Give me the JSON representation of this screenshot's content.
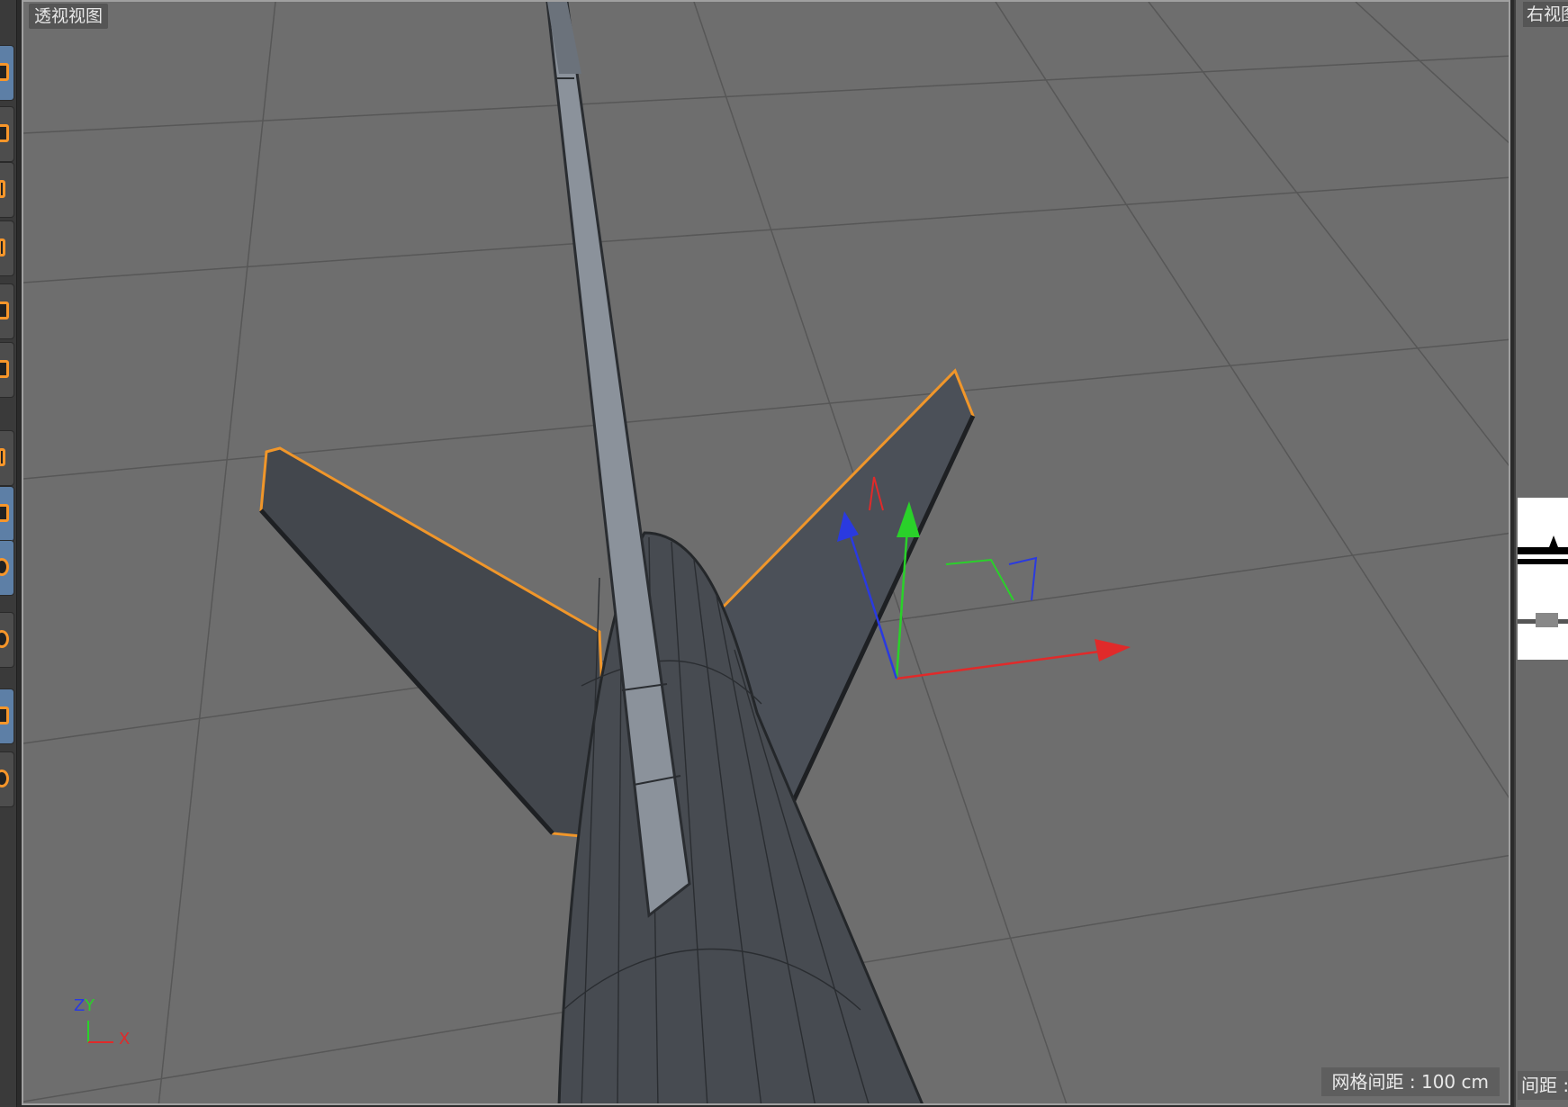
{
  "viewport": {
    "title": "透视视图",
    "grid_spacing": "网格间距 : 100 cm",
    "axis_gizmo": {
      "y_label": "Y",
      "z_label": "Z",
      "x_label": "X"
    },
    "colors": {
      "background": "#6e6e6e",
      "grid_line": "#5a5a5a",
      "model_fill": "#43474d",
      "model_edge": "#2a2d31",
      "model_highlight": "#8b929b",
      "selection_outline": "#f0962a",
      "axis_x": "#e02a2a",
      "axis_y": "#2ad12a",
      "axis_z": "#2a3ae0"
    }
  },
  "right_viewport": {
    "title": "右视图",
    "grid_spacing": "间距 :"
  },
  "toolbar": {
    "tools": [
      {
        "icon": "cube-icon",
        "active": true
      },
      {
        "icon": "camera-icon",
        "active": false
      },
      {
        "icon": "plane-icon",
        "active": false
      },
      {
        "icon": "spline-pen-icon",
        "active": false
      },
      {
        "icon": "cylinder-icon",
        "active": false
      },
      {
        "icon": "box-icon",
        "active": false
      },
      {
        "icon": "arrow-icon",
        "active": false
      },
      {
        "icon": "subdivision-icon",
        "active": true
      },
      {
        "icon": "sphere-icon",
        "active": true
      },
      {
        "icon": "deformer-icon",
        "active": false
      },
      {
        "icon": "scene-icon",
        "active": true
      },
      {
        "icon": "light-icon",
        "active": false
      }
    ]
  }
}
